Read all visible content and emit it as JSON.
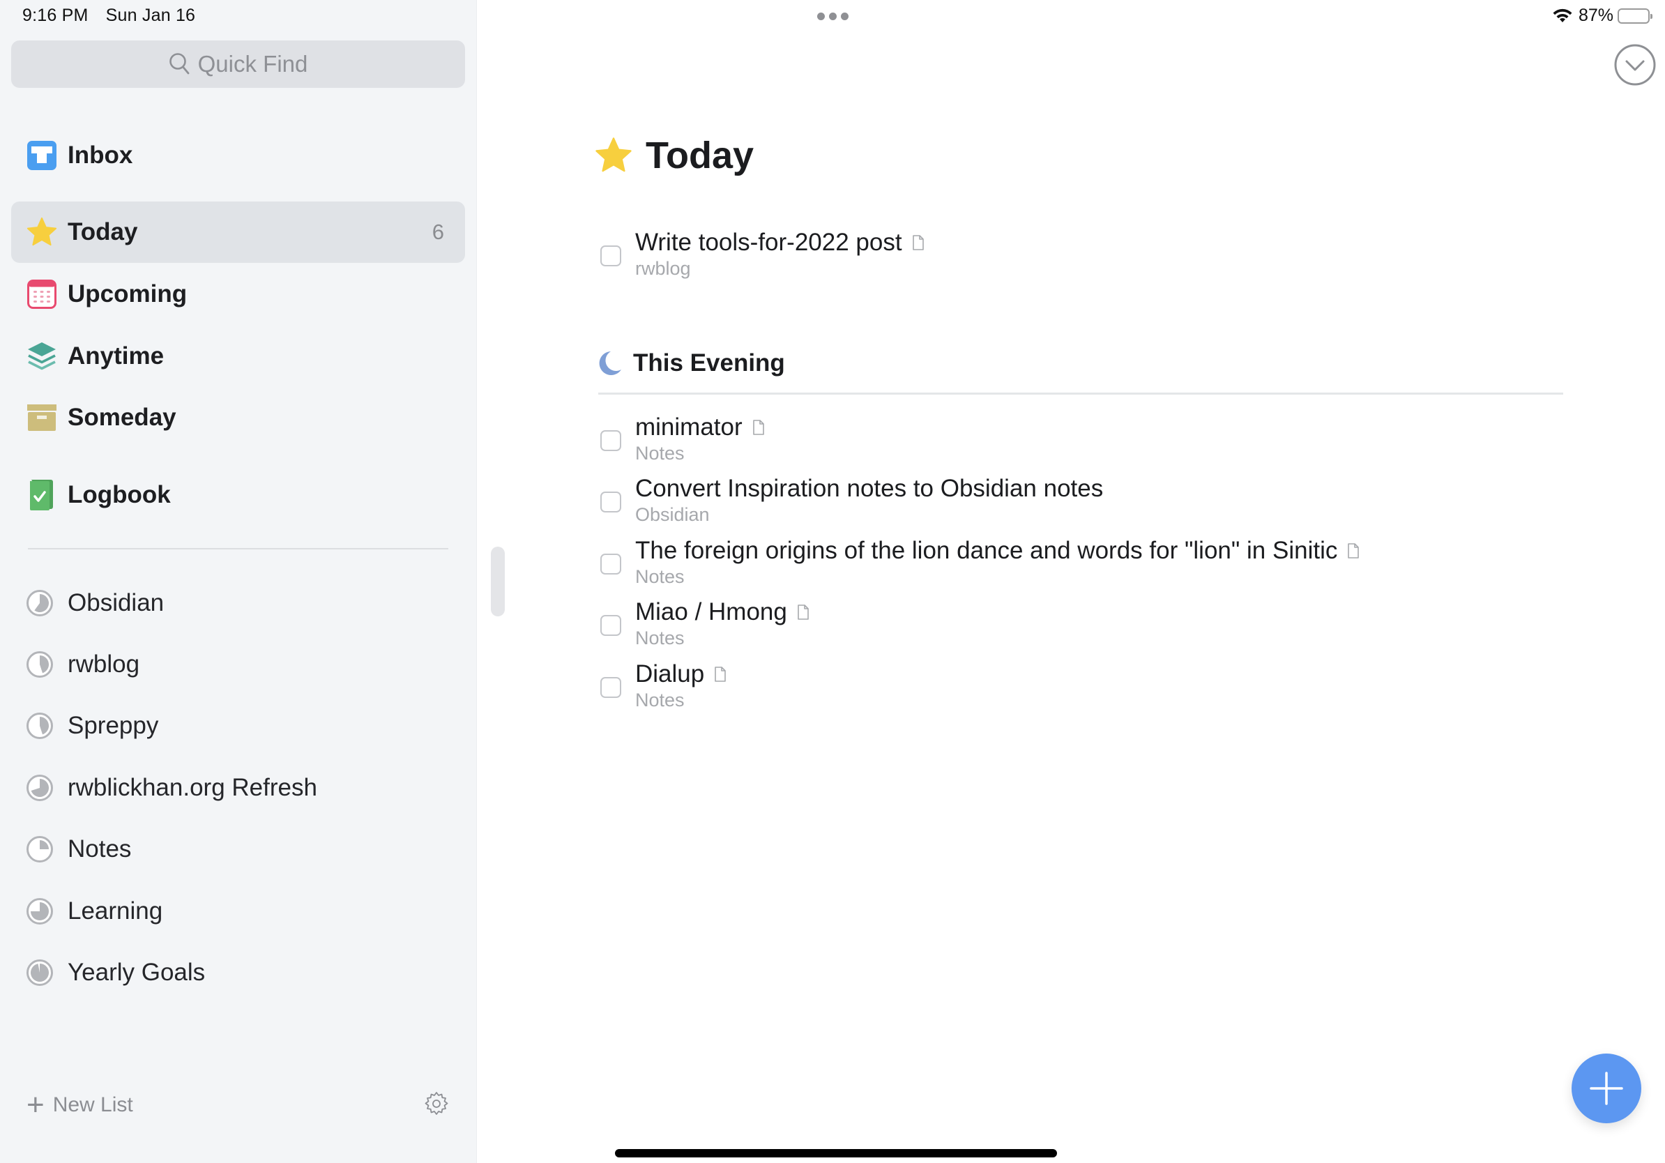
{
  "status_bar": {
    "time": "9:16 PM",
    "date": "Sun Jan 16",
    "battery_percent_label": "87%",
    "battery_level": 0.87,
    "wifi_icon": "wifi-icon"
  },
  "sidebar": {
    "search": {
      "placeholder": "Quick Find",
      "icon": "search-icon"
    },
    "nav": [
      {
        "id": "inbox",
        "label": "Inbox",
        "icon": "inbox-icon",
        "color": "#4a9ef0",
        "badge": null,
        "selected": false
      },
      {
        "id": "today",
        "label": "Today",
        "icon": "star-icon",
        "color": "#f7cf3e",
        "badge": "6",
        "selected": true
      },
      {
        "id": "upcoming",
        "label": "Upcoming",
        "icon": "calendar-icon",
        "color": "#e84a6f",
        "badge": null,
        "selected": false
      },
      {
        "id": "anytime",
        "label": "Anytime",
        "icon": "layers-icon",
        "color": "#4aa595",
        "badge": null,
        "selected": false
      },
      {
        "id": "someday",
        "label": "Someday",
        "icon": "archive-box-icon",
        "color": "#cdbd7c",
        "badge": null,
        "selected": false
      },
      {
        "id": "logbook",
        "label": "Logbook",
        "icon": "logbook-icon",
        "color": "#5fba6a",
        "badge": null,
        "selected": false
      }
    ],
    "projects": [
      {
        "label": "Obsidian",
        "progress": 0.6
      },
      {
        "label": "rwblog",
        "progress": 0.45
      },
      {
        "label": "Spreppy",
        "progress": 0.45
      },
      {
        "label": "rwblickhan.org Refresh",
        "progress": 0.7
      },
      {
        "label": "Notes",
        "progress": 0.25
      },
      {
        "label": "Learning",
        "progress": 0.75
      },
      {
        "label": "Yearly Goals",
        "progress": 0.97
      }
    ],
    "footer": {
      "new_list_label": "New List",
      "settings_icon": "gear-icon"
    }
  },
  "main": {
    "title": "Today",
    "title_icon": "star-icon",
    "tasks": [
      {
        "title": "Write tools-for-2022 post",
        "project": "rwblog",
        "has_notes": true,
        "checked": false
      }
    ],
    "sections": [
      {
        "title": "This Evening",
        "icon": "moon-icon",
        "tasks": [
          {
            "title": "minimator",
            "project": "Notes",
            "has_notes": true,
            "checked": false
          },
          {
            "title": "Convert Inspiration notes to Obsidian notes",
            "project": "Obsidian",
            "has_notes": false,
            "checked": false
          },
          {
            "title": "The foreign origins of the lion dance and words for \"lion\" in Sinitic",
            "project": "Notes",
            "has_notes": true,
            "checked": false
          },
          {
            "title": "Miao / Hmong",
            "project": "Notes",
            "has_notes": true,
            "checked": false
          },
          {
            "title": "Dialup",
            "project": "Notes",
            "has_notes": true,
            "checked": false
          }
        ]
      }
    ],
    "colors": {
      "accent": "#5c97f1",
      "moon": "#7f9fd6",
      "star": "#f7cf3e"
    }
  }
}
